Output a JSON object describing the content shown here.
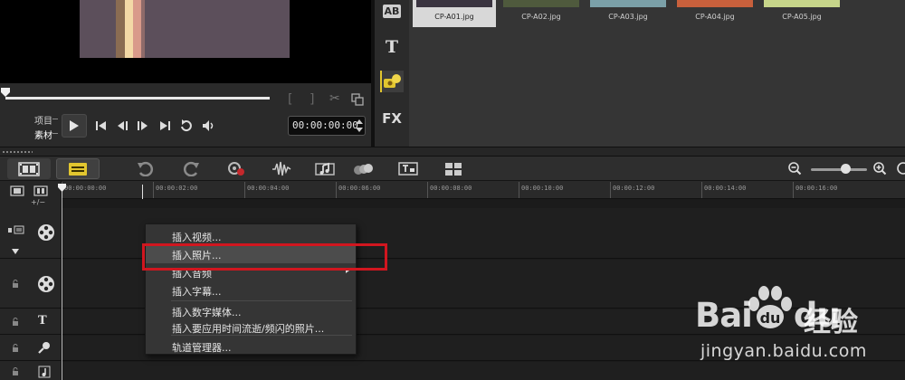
{
  "preview": {
    "mode_project": "项目",
    "mode_clip": "素材",
    "timecode": "00:00:00:00",
    "bracket_in": "[",
    "bracket_out": "]",
    "scrub_progress": 0.0
  },
  "library": {
    "side_icons": [
      "text-ab-icon",
      "title-t-icon",
      "graphics-icon",
      "fx-icon"
    ],
    "side_labels": {
      "ab": "AB",
      "title": "T",
      "fx": "FX"
    },
    "thumbnails": [
      {
        "name": "CP-A01.jpg",
        "color": "#3a3440",
        "selected": true
      },
      {
        "name": "CP-A02.jpg",
        "color": "#4f5a3d"
      },
      {
        "name": "CP-A03.jpg",
        "color": "#7ba0a8"
      },
      {
        "name": "CP-A04.jpg",
        "color": "#c8603c"
      },
      {
        "name": "CP-A05.jpg",
        "color": "#c6d58a"
      }
    ]
  },
  "ruler": {
    "ticks": [
      "00:00:00:00",
      "00:00:02:00",
      "00:00:04:00",
      "00:00:06:00",
      "00:00:08:00",
      "00:00:10:00",
      "00:00:12:00",
      "00:00:14:00",
      "00:00:16:00"
    ],
    "plusminus": "+/−"
  },
  "context_menu": {
    "items": [
      {
        "label": "插入视频..."
      },
      {
        "label": "插入照片...",
        "highlighted": true
      },
      {
        "label": "插入音频",
        "submenu": true
      },
      {
        "label": "插入字幕..."
      },
      {
        "label": "插入数字媒体..."
      },
      {
        "label": "插入要应用时间流逝/频闪的照片..."
      },
      {
        "label": "轨道管理器..."
      }
    ]
  },
  "watermark": {
    "brand": "Bai",
    "brand_tail": "du",
    "cn": "经验",
    "url": "jingyan.baidu.com"
  },
  "colors": {
    "highlight": "#d1161f",
    "accent_yellow": "#e2c62f"
  }
}
